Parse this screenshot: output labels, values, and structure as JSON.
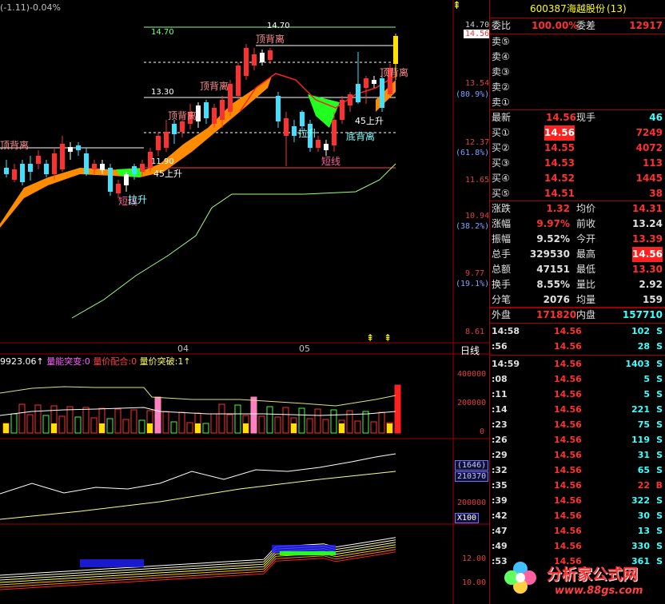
{
  "top_bar": {
    "indicator_text": "(-1.11)-0.04%",
    "stock_code": "600387",
    "stock_name": "海越股份",
    "stock_suffix": "(13)"
  },
  "price_axis": {
    "labels": [
      "14.70",
      "14.56",
      "13.54",
      "(80.9%)",
      "12.37",
      "(61.8%)",
      "11.65",
      "10.94",
      "(38.2%)",
      "9.77",
      "(19.1%)",
      "8.61"
    ]
  },
  "chart_annotations": {
    "level_labels": [
      "14.70",
      "14.70",
      "13.30",
      "11.90"
    ],
    "signals": [
      "顶背离",
      "顶背离",
      "顶背离",
      "顶背离",
      "顶背离",
      "底背离",
      "短线",
      "短线",
      "拉升",
      "拉升",
      "45上升",
      "45上升"
    ]
  },
  "date_axis": {
    "labels": [
      "04",
      "05"
    ],
    "period": "日线"
  },
  "volume_panel": {
    "header": "9923.06↑量能突变:0  量价配合:0  量价突破:1↑",
    "header_parts": [
      "9923.06↑",
      "量能突变:0",
      "量价配合:0",
      "量价突破:1↑"
    ],
    "axis": [
      "400000",
      "200000",
      "0"
    ]
  },
  "obv_panel": {
    "axis": [
      "(1646)",
      "210370",
      "200000",
      "X100"
    ]
  },
  "ma_panel": {
    "axis": [
      "12.00",
      "10.00"
    ]
  },
  "quote": {
    "weibi_label": "委比",
    "weibi_value": "100.00%",
    "weicha_label": "委差",
    "weicha_value": "12917",
    "sell_levels": [
      "卖⑤",
      "卖④",
      "卖③",
      "卖②",
      "卖①"
    ],
    "latest_label": "最新",
    "latest_value": "14.56",
    "xianshou_label": "现手",
    "xianshou_value": "46",
    "buy_levels": [
      {
        "label": "买①",
        "price": "14.56",
        "vol": "7249"
      },
      {
        "label": "买②",
        "price": "14.55",
        "vol": "4072"
      },
      {
        "label": "买③",
        "price": "14.53",
        "vol": "113"
      },
      {
        "label": "买④",
        "price": "14.52",
        "vol": "1445"
      },
      {
        "label": "买⑤",
        "price": "14.51",
        "vol": "38"
      }
    ],
    "stats": [
      {
        "l1": "涨跌",
        "v1": "1.32",
        "l2": "均价",
        "v2": "14.31"
      },
      {
        "l1": "涨幅",
        "v1": "9.97%",
        "l2": "前收",
        "v2": "13.24"
      },
      {
        "l1": "振幅",
        "v1": "9.52%",
        "l2": "今开",
        "v2": "13.39"
      },
      {
        "l1": "总手",
        "v1": "329530",
        "l2": "最高",
        "v2": "14.56"
      },
      {
        "l1": "总额",
        "v1": "47151",
        "l2": "最低",
        "v2": "13.30"
      },
      {
        "l1": "换手",
        "v1": "8.55%",
        "l2": "量比",
        "v2": "2.92"
      },
      {
        "l1": "分笔",
        "v1": "2076",
        "l2": "均量",
        "v2": "159"
      }
    ],
    "waipan_label": "外盘",
    "waipan_value": "171820",
    "neipan_label": "内盘",
    "neipan_value": "157710",
    "ticks": [
      {
        "t": "14:58",
        "p": "14.56",
        "v": "102",
        "s": "S"
      },
      {
        "t": ":56",
        "p": "14.56",
        "v": "28",
        "s": "S"
      },
      {
        "t": "14:59",
        "p": "14.56",
        "v": "1403",
        "s": "S"
      },
      {
        "t": ":08",
        "p": "14.56",
        "v": "5",
        "s": "S"
      },
      {
        "t": ":11",
        "p": "14.56",
        "v": "5",
        "s": "S"
      },
      {
        "t": ":14",
        "p": "14.56",
        "v": "221",
        "s": "S"
      },
      {
        "t": ":23",
        "p": "14.56",
        "v": "75",
        "s": "S"
      },
      {
        "t": ":26",
        "p": "14.56",
        "v": "119",
        "s": "S"
      },
      {
        "t": ":29",
        "p": "14.56",
        "v": "31",
        "s": "S"
      },
      {
        "t": ":32",
        "p": "14.56",
        "v": "65",
        "s": "S"
      },
      {
        "t": ":35",
        "p": "14.56",
        "v": "22",
        "s": "B"
      },
      {
        "t": ":39",
        "p": "14.56",
        "v": "322",
        "s": "S"
      },
      {
        "t": ":42",
        "p": "14.56",
        "v": "30",
        "s": "S"
      },
      {
        "t": ":47",
        "p": "14.56",
        "v": "13",
        "s": "S"
      },
      {
        "t": ":49",
        "p": "14.56",
        "v": "330",
        "s": "S"
      },
      {
        "t": ":53",
        "p": "14.56",
        "v": "361",
        "s": "S"
      }
    ]
  },
  "watermark": {
    "title": "分析家公式网",
    "url": "www.88gs.com"
  }
}
